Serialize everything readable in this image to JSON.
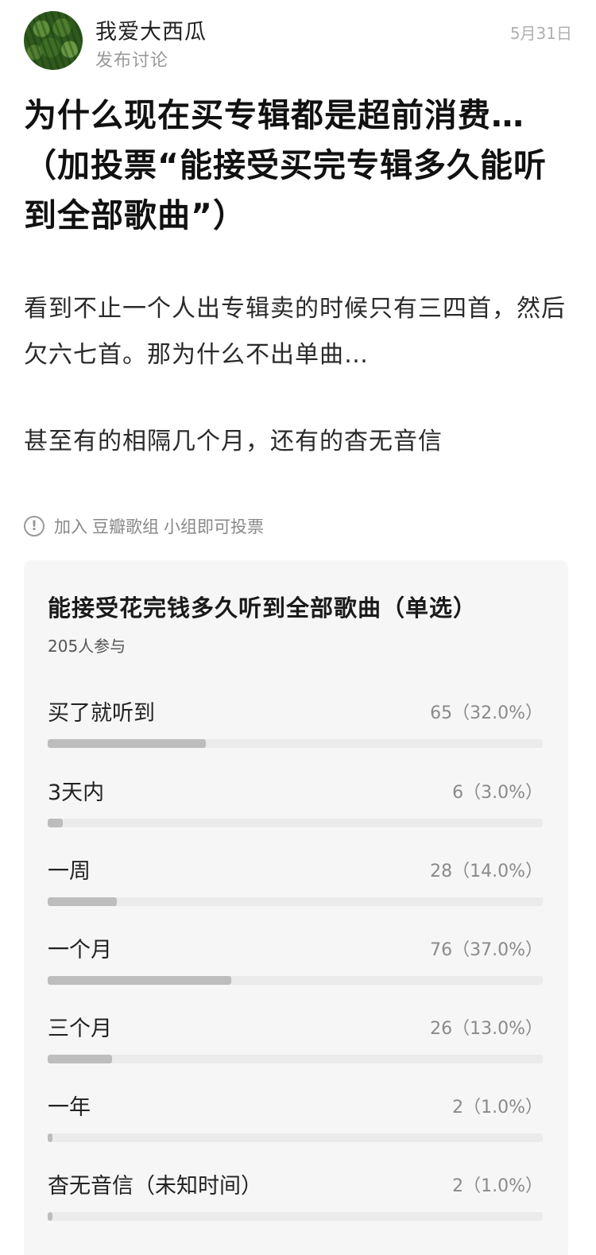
{
  "author": {
    "name": "我爱大西瓜",
    "action": "发布讨论",
    "date": "5月31日"
  },
  "post": {
    "title": "为什么现在买专辑都是超前消费…（加投票“能接受买完专辑多久能听到全部歌曲”）",
    "paragraphs": [
      "看到不止一个人出专辑卖的时候只有三四首，然后欠六七首。那为什么不出单曲…",
      "甚至有的相隔几个月，还有的杳无音信"
    ]
  },
  "notice": {
    "icon": "info-circle-icon",
    "prefix": "加入",
    "group": "豆瓣歌组",
    "suffix": "小组即可投票"
  },
  "poll": {
    "title": "能接受花完钱多久听到全部歌曲（单选）",
    "participants": "205人参与",
    "bar_color": "#bdbdbd",
    "track_color": "#ebebeb",
    "options": [
      {
        "label": "买了就听到",
        "stat": "65（32.0%）",
        "percent": 32.0
      },
      {
        "label": "3天内",
        "stat": "6（3.0%）",
        "percent": 3.0
      },
      {
        "label": "一周",
        "stat": "28（14.0%）",
        "percent": 14.0
      },
      {
        "label": "一个月",
        "stat": "76（37.0%）",
        "percent": 37.0
      },
      {
        "label": "三个月",
        "stat": "26（13.0%）",
        "percent": 13.0
      },
      {
        "label": "一年",
        "stat": "2（1.0%）",
        "percent": 1.0
      },
      {
        "label": "杳无音信（未知时间）",
        "stat": "2（1.0%）",
        "percent": 1.0
      }
    ]
  }
}
